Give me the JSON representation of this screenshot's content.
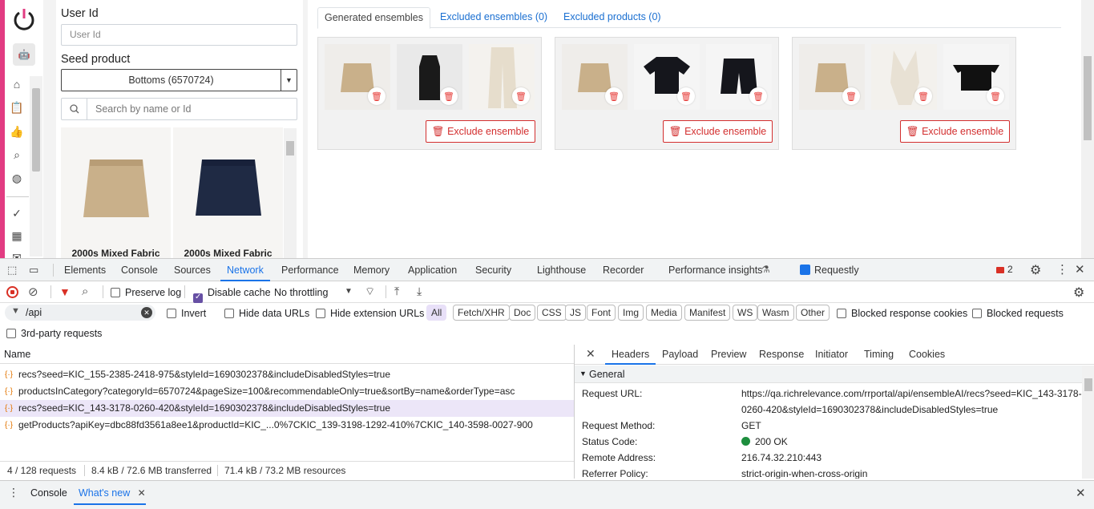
{
  "app": {
    "user_id_label": "User Id",
    "user_id_placeholder": "User Id",
    "seed_label": "Seed product",
    "seed_value": "Bottoms (6570724)",
    "search_placeholder": "Search by name or Id",
    "products": [
      {
        "name": "2000s Mixed Fabric"
      },
      {
        "name": "2000s Mixed Fabric"
      }
    ],
    "tabs": [
      "Generated ensembles",
      "Excluded ensembles (0)",
      "Excluded products (0)"
    ],
    "exclude_label": "Exclude ensemble"
  },
  "devtools": {
    "tabs": [
      "Elements",
      "Console",
      "Sources",
      "Network",
      "Performance",
      "Memory",
      "Application",
      "Security",
      "Lighthouse",
      "Recorder",
      "Performance insights",
      "Requestly"
    ],
    "issues_count": "2",
    "toolbar": {
      "preserve_log": "Preserve log",
      "disable_cache": "Disable cache",
      "throttling": "No throttling"
    },
    "filter": {
      "value": "/api",
      "invert": "Invert",
      "hide_data_urls": "Hide data URLs",
      "hide_ext_urls": "Hide extension URLs",
      "chips": [
        "All",
        "Fetch/XHR",
        "Doc",
        "CSS",
        "JS",
        "Font",
        "Img",
        "Media",
        "Manifest",
        "WS",
        "Wasm",
        "Other"
      ],
      "blocked_cookies": "Blocked response cookies",
      "blocked_requests": "Blocked requests",
      "third_party": "3rd-party requests"
    },
    "name_header": "Name",
    "requests": [
      "recs?seed=KIC_155-2385-2418-975&styleId=1690302378&includeDisabledStyles=true",
      "productsInCategory?categoryId=6570724&pageSize=100&recommendableOnly=true&sortBy=name&orderType=asc",
      "recs?seed=KIC_143-3178-0260-420&styleId=1690302378&includeDisabledStyles=true",
      "getProducts?apiKey=dbc88fd3561a8ee1&productId=KIC_...0%7CKIC_139-3198-1292-410%7CKIC_140-3598-0027-900"
    ],
    "status": {
      "requests": "4 / 128 requests",
      "transferred": "8.4 kB / 72.6 MB transferred",
      "resources": "71.4 kB / 73.2 MB resources"
    },
    "detail_tabs": [
      "Headers",
      "Payload",
      "Preview",
      "Response",
      "Initiator",
      "Timing",
      "Cookies"
    ],
    "general": {
      "title": "General",
      "request_url_label": "Request URL:",
      "request_url_line1": "https://qa.richrelevance.com/rrportal/api/ensembleAI/recs?seed=KIC_143-3178-",
      "request_url_line2": "0260-420&styleId=1690302378&includeDisabledStyles=true",
      "method_label": "Request Method:",
      "method": "GET",
      "status_label": "Status Code:",
      "status": "200 OK",
      "remote_label": "Remote Address:",
      "remote": "216.74.32.210:443",
      "referrer_label": "Referrer Policy:",
      "referrer": "strict-origin-when-cross-origin"
    },
    "drawer_tabs": [
      "Console",
      "What's new"
    ]
  },
  "colors": {
    "accent": "#e23c82",
    "blue": "#1a73e8",
    "danger": "#d32f2f",
    "ok": "#1e8e3e"
  }
}
